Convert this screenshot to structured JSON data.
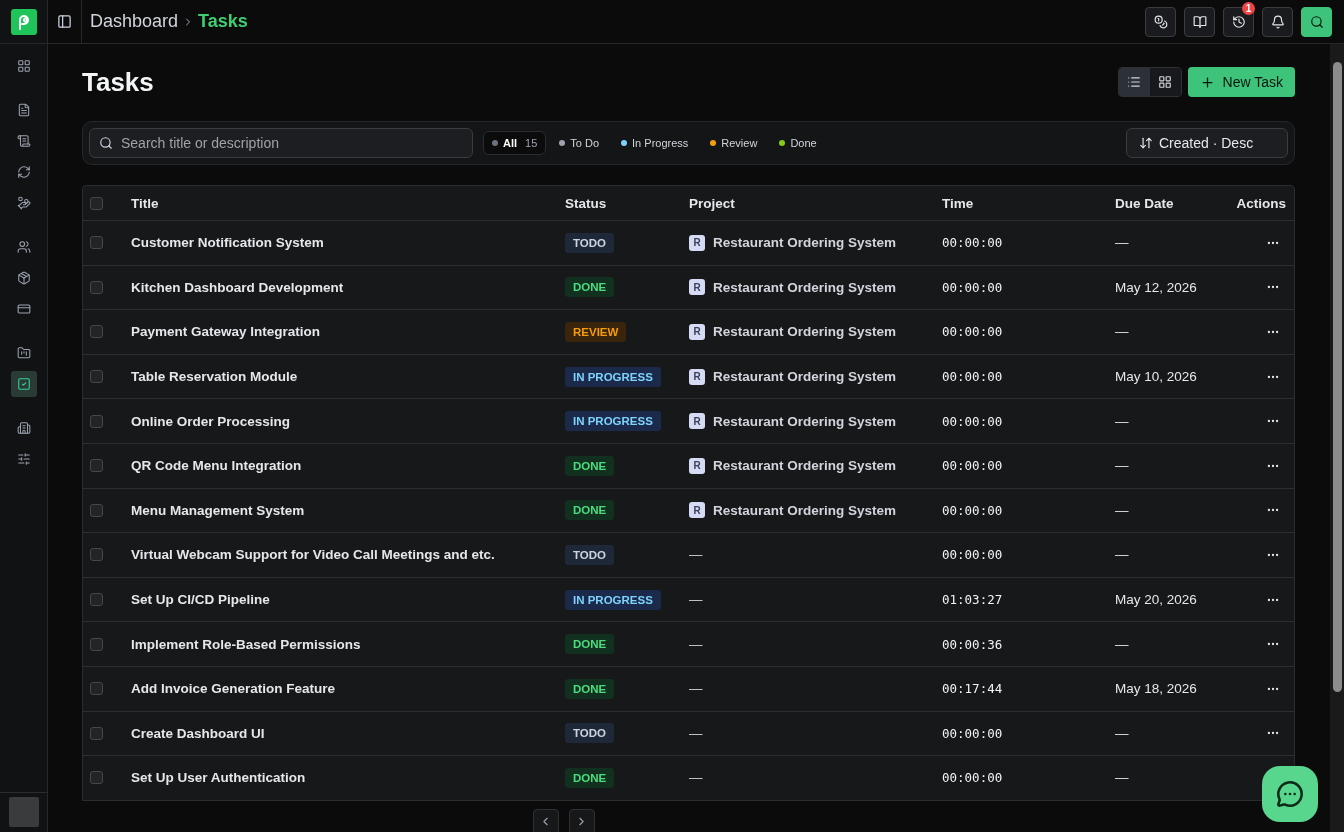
{
  "sidebar": {
    "items": [
      {
        "selected": false
      },
      {
        "selected": false
      },
      {
        "selected": false
      },
      {
        "selected": false
      },
      {
        "selected": false
      },
      {
        "selected": false
      },
      {
        "selected": false
      },
      {
        "selected": false
      },
      {
        "selected": false
      },
      {
        "selected": true
      },
      {
        "selected": false
      },
      {
        "selected": false
      }
    ]
  },
  "breadcrumb": [
    {
      "label": "Dashboard",
      "current": false
    },
    {
      "label": "Tasks",
      "current": true
    }
  ],
  "topbar": {
    "history_badge": "1"
  },
  "page_title": "Tasks",
  "view_toggle": [
    {
      "selected": true
    },
    {
      "selected": false
    }
  ],
  "new_task_button": "New Task",
  "search": {
    "placeholder": "Search title or description"
  },
  "filters": [
    {
      "label": "All",
      "count": "15",
      "color": "#6b7280",
      "selected": true
    },
    {
      "label": "To Do",
      "color": "#9ca3af",
      "selected": false
    },
    {
      "label": "In Progress",
      "color": "#7dd3fc",
      "selected": false
    },
    {
      "label": "Review",
      "color": "#f59e0b",
      "selected": false
    },
    {
      "label": "Done",
      "color": "#84cc16",
      "selected": false
    }
  ],
  "sort": "Created · Desc",
  "table": {
    "select_all": {
      "checked": false
    },
    "columns": [
      "Title",
      "Status",
      "Project",
      "Time",
      "Due Date",
      "Actions"
    ],
    "rows": [
      {
        "checked": false,
        "title": "Customer Notification System",
        "status": {
          "label": "TODO",
          "kind": "todo"
        },
        "project": {
          "initial": "R",
          "name": "Restaurant Ordering System"
        },
        "time": "00:00:00",
        "due_date": "—"
      },
      {
        "checked": false,
        "title": "Kitchen Dashboard Development",
        "status": {
          "label": "DONE",
          "kind": "done"
        },
        "project": {
          "initial": "R",
          "name": "Restaurant Ordering System"
        },
        "time": "00:00:00",
        "due_date": "May 12, 2026"
      },
      {
        "checked": false,
        "title": "Payment Gateway Integration",
        "status": {
          "label": "REVIEW",
          "kind": "review"
        },
        "project": {
          "initial": "R",
          "name": "Restaurant Ordering System"
        },
        "time": "00:00:00",
        "due_date": "—"
      },
      {
        "checked": false,
        "title": "Table Reservation Module",
        "status": {
          "label": "IN PROGRESS",
          "kind": "in_progress"
        },
        "project": {
          "initial": "R",
          "name": "Restaurant Ordering System"
        },
        "time": "00:00:00",
        "due_date": "May 10, 2026"
      },
      {
        "checked": false,
        "title": "Online Order Processing",
        "status": {
          "label": "IN PROGRESS",
          "kind": "in_progress"
        },
        "project": {
          "initial": "R",
          "name": "Restaurant Ordering System"
        },
        "time": "00:00:00",
        "due_date": "—"
      },
      {
        "checked": false,
        "title": "QR Code Menu Integration",
        "status": {
          "label": "DONE",
          "kind": "done"
        },
        "project": {
          "initial": "R",
          "name": "Restaurant Ordering System"
        },
        "time": "00:00:00",
        "due_date": "—"
      },
      {
        "checked": false,
        "title": "Menu Management System",
        "status": {
          "label": "DONE",
          "kind": "done"
        },
        "project": {
          "initial": "R",
          "name": "Restaurant Ordering System"
        },
        "time": "00:00:00",
        "due_date": "—"
      },
      {
        "checked": false,
        "title": "Virtual Webcam Support for Video Call Meetings and etc.",
        "status": {
          "label": "TODO",
          "kind": "todo"
        },
        "project_none": "—",
        "time": "00:00:00",
        "due_date": "—"
      },
      {
        "checked": false,
        "title": "Set Up CI/CD Pipeline",
        "status": {
          "label": "IN PROGRESS",
          "kind": "in_progress"
        },
        "project_none": "—",
        "time": "01:03:27",
        "due_date": "May 20, 2026"
      },
      {
        "checked": false,
        "title": "Implement Role-Based Permissions",
        "status": {
          "label": "DONE",
          "kind": "done"
        },
        "project_none": "—",
        "time": "00:00:36",
        "due_date": "—"
      },
      {
        "checked": false,
        "title": "Add Invoice Generation Feature",
        "status": {
          "label": "DONE",
          "kind": "done"
        },
        "project_none": "—",
        "time": "00:17:44",
        "due_date": "May 18, 2026"
      },
      {
        "checked": false,
        "title": "Create Dashboard UI",
        "status": {
          "label": "TODO",
          "kind": "todo"
        },
        "project_none": "—",
        "time": "00:00:00",
        "due_date": "—"
      },
      {
        "checked": false,
        "title": "Set Up User Authentication",
        "status": {
          "label": "DONE",
          "kind": "done"
        },
        "project_none": "—",
        "time": "00:00:00",
        "due_date": "—",
        "actions_button": false
      }
    ]
  }
}
